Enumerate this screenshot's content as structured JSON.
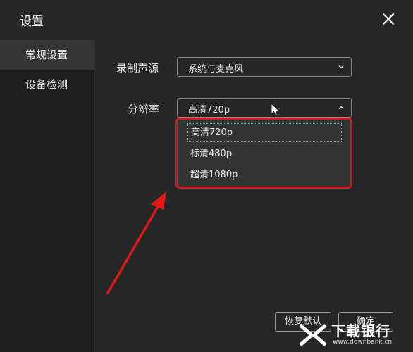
{
  "window": {
    "title": "设置"
  },
  "sidebar": {
    "items": [
      {
        "label": "常规设置",
        "active": true
      },
      {
        "label": "设备检测",
        "active": false
      }
    ]
  },
  "general": {
    "audio_source": {
      "label": "录制声源",
      "value": "系统与麦克风"
    },
    "resolution": {
      "label": "分辨率",
      "value": "高清720p",
      "options": [
        "高清720p",
        "标清480p",
        "超清1080p"
      ],
      "selected_index": 0
    }
  },
  "footer": {
    "restore_label": "恢复默认",
    "confirm_label": "确定"
  },
  "watermark": {
    "text": "下载银行",
    "sub": "www.downbank.cn"
  },
  "colors": {
    "highlight": "#d11a1a",
    "background": "#262626",
    "sidebar": "#1e1e1e"
  }
}
